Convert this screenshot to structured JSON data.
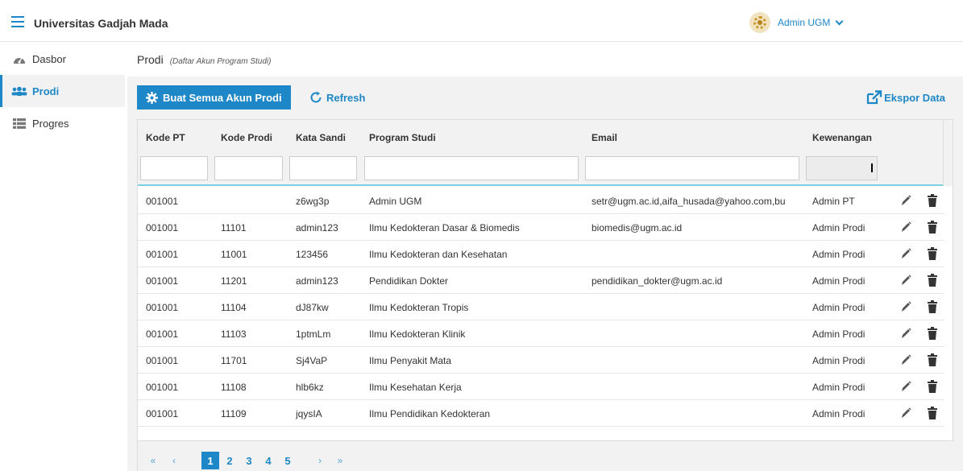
{
  "app": {
    "title": "Universitas Gadjah Mada"
  },
  "user": {
    "name": "Admin UGM"
  },
  "sidebar": {
    "items": [
      {
        "label": "Dasbor",
        "icon": "dashboard-icon"
      },
      {
        "label": "Prodi",
        "icon": "users-icon",
        "active": true
      },
      {
        "label": "Progres",
        "icon": "list-icon"
      }
    ]
  },
  "page": {
    "title": "Prodi",
    "subtitle": "(Daftar Akun Program Studi)"
  },
  "toolbar": {
    "create_all_label": "Buat Semua Akun Prodi",
    "refresh_label": "Refresh",
    "export_label": "Ekspor Data"
  },
  "table": {
    "columns": [
      "Kode PT",
      "Kode Prodi",
      "Kata Sandi",
      "Program Studi",
      "Email",
      "Kewenangan"
    ],
    "rows": [
      [
        "001001",
        "",
        "z6wg3p",
        "Admin UGM",
        "setr@ugm.ac.id,aifa_husada@yahoo.com,bu",
        "Admin PT"
      ],
      [
        "001001",
        "11101",
        "admin123",
        "Ilmu Kedokteran Dasar & Biomedis",
        "biomedis@ugm.ac.id",
        "Admin Prodi"
      ],
      [
        "001001",
        "11001",
        "123456",
        "Ilmu Kedokteran dan Kesehatan",
        "",
        "Admin Prodi"
      ],
      [
        "001001",
        "11201",
        "admin123",
        "Pendidikan Dokter",
        "pendidikan_dokter@ugm.ac.id",
        "Admin Prodi"
      ],
      [
        "001001",
        "11104",
        "dJ87kw",
        "Ilmu Kedokteran Tropis",
        "",
        "Admin Prodi"
      ],
      [
        "001001",
        "11103",
        "1ptmLm",
        "Ilmu Kedokteran Klinik",
        "",
        "Admin Prodi"
      ],
      [
        "001001",
        "11701",
        "Sj4VaP",
        "Ilmu Penyakit Mata",
        "",
        "Admin Prodi"
      ],
      [
        "001001",
        "11108",
        "hlb6kz",
        "Ilmu Kesehatan Kerja",
        "",
        "Admin Prodi"
      ],
      [
        "001001",
        "11109",
        "jqysIA",
        "Ilmu Pendidikan Kedokteran",
        "",
        "Admin Prodi"
      ]
    ]
  },
  "pagination": {
    "first": "«",
    "prev": "‹",
    "next": "›",
    "last": "»",
    "pages": [
      "1",
      "2",
      "3",
      "4",
      "5"
    ],
    "current": "1"
  },
  "colors": {
    "accent": "#1e87c7",
    "panel": "#f2f2f2",
    "header_rule": "#7ecfe0"
  }
}
